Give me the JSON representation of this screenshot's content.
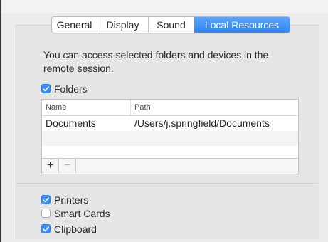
{
  "tabs": [
    {
      "label": "General",
      "active": false
    },
    {
      "label": "Display",
      "active": false
    },
    {
      "label": "Sound",
      "active": false
    },
    {
      "label": "Local Resources",
      "active": true
    }
  ],
  "description": "You can access selected folders and devices in the remote session.",
  "folders": {
    "label": "Folders",
    "checked": true,
    "columns": [
      "Name",
      "Path"
    ],
    "rows": [
      {
        "name": "Documents",
        "path": "/Users/j.springfield/Documents"
      }
    ],
    "add_label": "+",
    "remove_label": "−"
  },
  "devices": [
    {
      "label": "Printers",
      "checked": true
    },
    {
      "label": "Smart Cards",
      "checked": false
    },
    {
      "label": "Clipboard",
      "checked": true
    }
  ],
  "colors": {
    "accent": "#3f8ef7",
    "tab_active": "#2f86f6"
  }
}
